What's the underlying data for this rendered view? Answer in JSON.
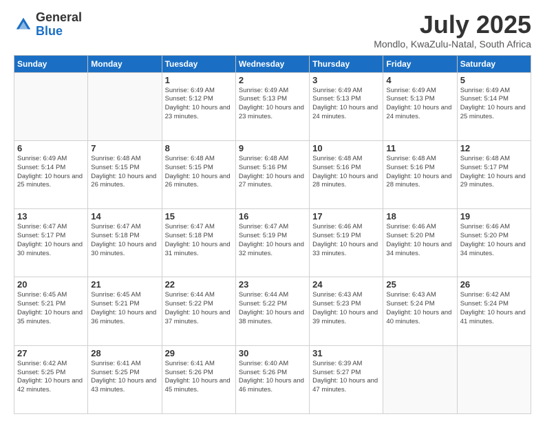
{
  "header": {
    "logo_general": "General",
    "logo_blue": "Blue",
    "title": "July 2025",
    "subtitle": "Mondlo, KwaZulu-Natal, South Africa"
  },
  "days_of_week": [
    "Sunday",
    "Monday",
    "Tuesday",
    "Wednesday",
    "Thursday",
    "Friday",
    "Saturday"
  ],
  "weeks": [
    [
      {
        "day": "",
        "info": ""
      },
      {
        "day": "",
        "info": ""
      },
      {
        "day": "1",
        "info": "Sunrise: 6:49 AM\nSunset: 5:12 PM\nDaylight: 10 hours and 23 minutes."
      },
      {
        "day": "2",
        "info": "Sunrise: 6:49 AM\nSunset: 5:13 PM\nDaylight: 10 hours and 23 minutes."
      },
      {
        "day": "3",
        "info": "Sunrise: 6:49 AM\nSunset: 5:13 PM\nDaylight: 10 hours and 24 minutes."
      },
      {
        "day": "4",
        "info": "Sunrise: 6:49 AM\nSunset: 5:13 PM\nDaylight: 10 hours and 24 minutes."
      },
      {
        "day": "5",
        "info": "Sunrise: 6:49 AM\nSunset: 5:14 PM\nDaylight: 10 hours and 25 minutes."
      }
    ],
    [
      {
        "day": "6",
        "info": "Sunrise: 6:49 AM\nSunset: 5:14 PM\nDaylight: 10 hours and 25 minutes."
      },
      {
        "day": "7",
        "info": "Sunrise: 6:48 AM\nSunset: 5:15 PM\nDaylight: 10 hours and 26 minutes."
      },
      {
        "day": "8",
        "info": "Sunrise: 6:48 AM\nSunset: 5:15 PM\nDaylight: 10 hours and 26 minutes."
      },
      {
        "day": "9",
        "info": "Sunrise: 6:48 AM\nSunset: 5:16 PM\nDaylight: 10 hours and 27 minutes."
      },
      {
        "day": "10",
        "info": "Sunrise: 6:48 AM\nSunset: 5:16 PM\nDaylight: 10 hours and 28 minutes."
      },
      {
        "day": "11",
        "info": "Sunrise: 6:48 AM\nSunset: 5:16 PM\nDaylight: 10 hours and 28 minutes."
      },
      {
        "day": "12",
        "info": "Sunrise: 6:48 AM\nSunset: 5:17 PM\nDaylight: 10 hours and 29 minutes."
      }
    ],
    [
      {
        "day": "13",
        "info": "Sunrise: 6:47 AM\nSunset: 5:17 PM\nDaylight: 10 hours and 30 minutes."
      },
      {
        "day": "14",
        "info": "Sunrise: 6:47 AM\nSunset: 5:18 PM\nDaylight: 10 hours and 30 minutes."
      },
      {
        "day": "15",
        "info": "Sunrise: 6:47 AM\nSunset: 5:18 PM\nDaylight: 10 hours and 31 minutes."
      },
      {
        "day": "16",
        "info": "Sunrise: 6:47 AM\nSunset: 5:19 PM\nDaylight: 10 hours and 32 minutes."
      },
      {
        "day": "17",
        "info": "Sunrise: 6:46 AM\nSunset: 5:19 PM\nDaylight: 10 hours and 33 minutes."
      },
      {
        "day": "18",
        "info": "Sunrise: 6:46 AM\nSunset: 5:20 PM\nDaylight: 10 hours and 34 minutes."
      },
      {
        "day": "19",
        "info": "Sunrise: 6:46 AM\nSunset: 5:20 PM\nDaylight: 10 hours and 34 minutes."
      }
    ],
    [
      {
        "day": "20",
        "info": "Sunrise: 6:45 AM\nSunset: 5:21 PM\nDaylight: 10 hours and 35 minutes."
      },
      {
        "day": "21",
        "info": "Sunrise: 6:45 AM\nSunset: 5:21 PM\nDaylight: 10 hours and 36 minutes."
      },
      {
        "day": "22",
        "info": "Sunrise: 6:44 AM\nSunset: 5:22 PM\nDaylight: 10 hours and 37 minutes."
      },
      {
        "day": "23",
        "info": "Sunrise: 6:44 AM\nSunset: 5:22 PM\nDaylight: 10 hours and 38 minutes."
      },
      {
        "day": "24",
        "info": "Sunrise: 6:43 AM\nSunset: 5:23 PM\nDaylight: 10 hours and 39 minutes."
      },
      {
        "day": "25",
        "info": "Sunrise: 6:43 AM\nSunset: 5:24 PM\nDaylight: 10 hours and 40 minutes."
      },
      {
        "day": "26",
        "info": "Sunrise: 6:42 AM\nSunset: 5:24 PM\nDaylight: 10 hours and 41 minutes."
      }
    ],
    [
      {
        "day": "27",
        "info": "Sunrise: 6:42 AM\nSunset: 5:25 PM\nDaylight: 10 hours and 42 minutes."
      },
      {
        "day": "28",
        "info": "Sunrise: 6:41 AM\nSunset: 5:25 PM\nDaylight: 10 hours and 43 minutes."
      },
      {
        "day": "29",
        "info": "Sunrise: 6:41 AM\nSunset: 5:26 PM\nDaylight: 10 hours and 45 minutes."
      },
      {
        "day": "30",
        "info": "Sunrise: 6:40 AM\nSunset: 5:26 PM\nDaylight: 10 hours and 46 minutes."
      },
      {
        "day": "31",
        "info": "Sunrise: 6:39 AM\nSunset: 5:27 PM\nDaylight: 10 hours and 47 minutes."
      },
      {
        "day": "",
        "info": ""
      },
      {
        "day": "",
        "info": ""
      }
    ]
  ]
}
